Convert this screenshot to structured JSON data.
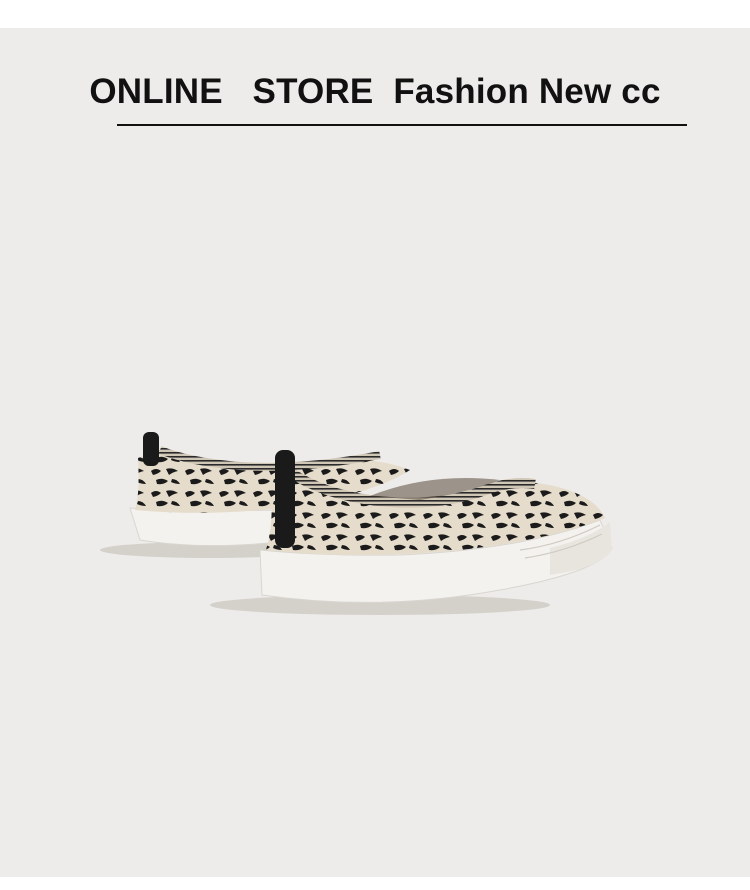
{
  "header": {
    "title": "ONLINE   STORE  Fashion New cc"
  },
  "product_image": {
    "subject": "pair of leopard-print knit slip-on sneakers with white rubber soles",
    "colors": {
      "background": "#eeecea",
      "knit_base": "#e6dccb",
      "print": "#1b1b1b",
      "sole": "#f4f2ee",
      "sole_shadow": "#d9d6d0",
      "heel_tab": "#1a1a1a"
    }
  }
}
